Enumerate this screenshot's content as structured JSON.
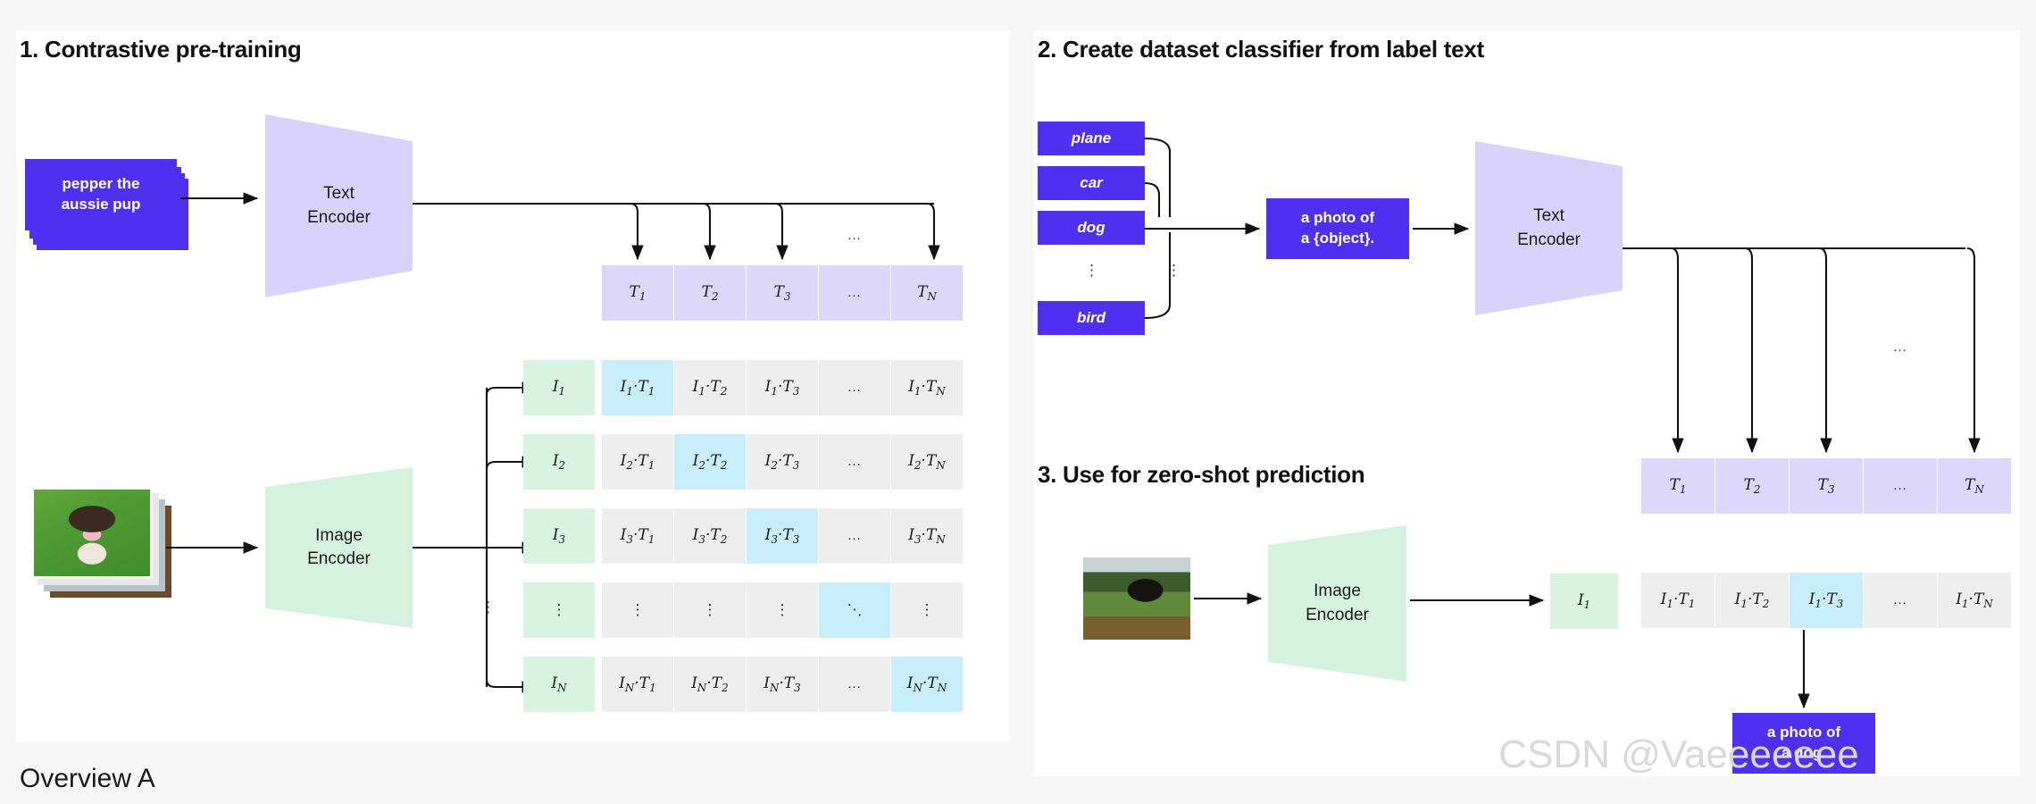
{
  "page": {
    "overview_label": "Overview A",
    "watermark": "CSDN @Vaeeeeeee"
  },
  "sections": {
    "s1": {
      "title": "1. Contrastive pre-training"
    },
    "s2": {
      "title": "2. Create dataset classifier from label text"
    },
    "s3": {
      "title": "3. Use for zero-shot prediction"
    }
  },
  "encoders": {
    "text": {
      "line1": "Text",
      "line2": "Encoder",
      "color": "#d9d2fb"
    },
    "image": {
      "line1": "Image",
      "line2": "Encoder",
      "color": "#d4f2de"
    }
  },
  "section1": {
    "caption_card": {
      "line1": "pepper the",
      "line2": "aussie pup"
    },
    "t_headers": [
      "T",
      "T",
      "T",
      "…",
      "T"
    ],
    "t_subs": [
      "1",
      "2",
      "3",
      "",
      "N"
    ],
    "i_headers": [
      "I",
      "I",
      "I",
      "⋮",
      "I"
    ],
    "i_subs": [
      "1",
      "2",
      "3",
      "",
      "N"
    ],
    "row_labels": [
      "I₁",
      "I₂",
      "I₃",
      "⋮",
      "I_N"
    ],
    "col_labels": [
      "T₁",
      "T₂",
      "T₃",
      "…",
      "T_N"
    ],
    "top_dots": "…",
    "left_vdots": "⋮",
    "matrix": [
      [
        {
          "t": "I·T",
          "a": "1",
          "b": "1",
          "hl": true
        },
        {
          "t": "I·T",
          "a": "1",
          "b": "2",
          "hl": false
        },
        {
          "t": "I·T",
          "a": "1",
          "b": "3",
          "hl": false
        },
        {
          "t": "dots",
          "a": "",
          "b": "",
          "hl": false
        },
        {
          "t": "I·T",
          "a": "1",
          "b": "N",
          "hl": false
        }
      ],
      [
        {
          "t": "I·T",
          "a": "2",
          "b": "1",
          "hl": false
        },
        {
          "t": "I·T",
          "a": "2",
          "b": "2",
          "hl": true
        },
        {
          "t": "I·T",
          "a": "2",
          "b": "3",
          "hl": false
        },
        {
          "t": "dots",
          "a": "",
          "b": "",
          "hl": false
        },
        {
          "t": "I·T",
          "a": "2",
          "b": "N",
          "hl": false
        }
      ],
      [
        {
          "t": "I·T",
          "a": "3",
          "b": "1",
          "hl": false
        },
        {
          "t": "I·T",
          "a": "3",
          "b": "2",
          "hl": false
        },
        {
          "t": "I·T",
          "a": "3",
          "b": "3",
          "hl": true
        },
        {
          "t": "dots",
          "a": "",
          "b": "",
          "hl": false
        },
        {
          "t": "I·T",
          "a": "3",
          "b": "N",
          "hl": false
        }
      ],
      [
        {
          "t": "vdots",
          "a": "",
          "b": "",
          "hl": false
        },
        {
          "t": "vdots",
          "a": "",
          "b": "",
          "hl": false
        },
        {
          "t": "vdots",
          "a": "",
          "b": "",
          "hl": false
        },
        {
          "t": "ddots",
          "a": "",
          "b": "",
          "hl": true
        },
        {
          "t": "vdots",
          "a": "",
          "b": "",
          "hl": false
        }
      ],
      [
        {
          "t": "I·T",
          "a": "N",
          "b": "1",
          "hl": false
        },
        {
          "t": "I·T",
          "a": "N",
          "b": "2",
          "hl": false
        },
        {
          "t": "I·T",
          "a": "N",
          "b": "3",
          "hl": false
        },
        {
          "t": "dots",
          "a": "",
          "b": "",
          "hl": false
        },
        {
          "t": "I·T",
          "a": "N",
          "b": "N",
          "hl": true
        }
      ]
    ]
  },
  "section2": {
    "labels": [
      "plane",
      "car",
      "dog",
      "bird"
    ],
    "vdots_left": "⋮",
    "vdots_right": "⋮",
    "prompt": {
      "line1": "a photo of",
      "line2": "a {object}."
    }
  },
  "section3": {
    "image_embedding": {
      "t": "I",
      "sub": "1"
    },
    "t_cells": [
      {
        "t": "T",
        "sub": "1"
      },
      {
        "t": "T",
        "sub": "2"
      },
      {
        "t": "T",
        "sub": "3"
      },
      {
        "t": "dots",
        "sub": ""
      },
      {
        "t": "T",
        "sub": "N"
      }
    ],
    "score_cells": [
      {
        "t": "I·T",
        "a": "1",
        "b": "1",
        "hl": false
      },
      {
        "t": "I·T",
        "a": "1",
        "b": "2",
        "hl": false
      },
      {
        "t": "I·T",
        "a": "1",
        "b": "3",
        "hl": true
      },
      {
        "t": "dots",
        "a": "",
        "b": "",
        "hl": false
      },
      {
        "t": "I·T",
        "a": "1",
        "b": "N",
        "hl": false
      }
    ],
    "top_dots": "…",
    "prediction": {
      "line1": "a photo of",
      "line2": "a dog."
    }
  },
  "colors": {
    "brand_purple": "#4f30f0",
    "encoder_purple": "#d9d2fb",
    "encoder_green": "#d4f2de",
    "cell_t": "#ddd7fb",
    "cell_i": "#d8f3e0",
    "cell_grey": "#eeeeee",
    "cell_highlight": "#c8edfb",
    "panel_bg": "#ffffff",
    "page_bg": "#f7f7f8"
  }
}
